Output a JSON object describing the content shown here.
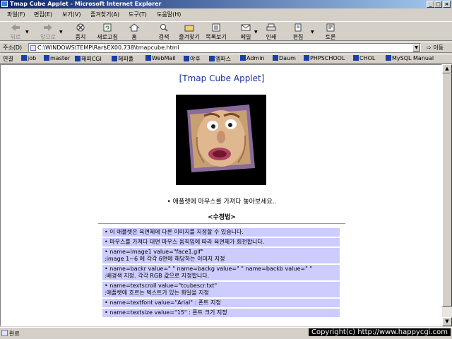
{
  "window": {
    "title": "Tmap Cube Applet - Microsoft Internet Explorer",
    "buttons": [
      "_",
      "□",
      "×"
    ]
  },
  "menu": [
    "파일(F)",
    "편집(E)",
    "보기(V)",
    "즐겨찾기(A)",
    "도구(T)",
    "도움말(H)"
  ],
  "toolbar": {
    "back": "뒤로",
    "forward": "앞으로",
    "stop": "중지",
    "refresh": "새로고침",
    "home": "홈",
    "search": "검색",
    "favorites": "즐겨찾기",
    "history": "목록보기",
    "mail": "메일",
    "print": "인쇄",
    "edit": "편집",
    "discuss": "토론"
  },
  "address": {
    "label": "주소(D)",
    "url": "C:\\WINDOWS\\TEMP\\Rar$EX00.738\\tmapcube.html",
    "go": "이동"
  },
  "links": {
    "label": "연결",
    "items": [
      "job",
      "master",
      "해피CGI",
      "해피폴",
      "WebMail",
      "야후",
      "엠파스",
      "Admin",
      "Daum",
      "PHPSCHOOL",
      "CHOL",
      "MySQL Manual"
    ]
  },
  "page": {
    "title": "[Tmap Cube Applet]",
    "hint": "• 애플렛에 마우스를 가져다 놓아보세요..",
    "method_title": "<수정법>",
    "rows": [
      [
        "• 이 애플렛은 육면체에 다른 이미지를 지정할 수 있습니다."
      ],
      [
        "• 마우스를 가져다 대면 마우스 움직임에 따라 육면체가 회전합니다."
      ],
      [
        "• name=image1 value=\"face1.gif\"",
        "  :image 1~6 에 각각 6면에 해당하는 이미지 지정"
      ],
      [
        "• name=backr value=\" \" name=backg value=\" \" name=backb value=\" \"",
        "  :배경색 지정. 각각 RGB 값으로 지정합니다."
      ],
      [
        "• name=textscroll value=\"tcubescr.txt\"",
        "  :애플렛에 흐르는 텍스트가 있는 화일을 지정"
      ],
      [
        "• name=textfont value=\"Arial\" : 폰트 지정"
      ],
      [
        "• name=textsize value=\"15\" : 폰트 크기 지정"
      ]
    ]
  },
  "status": {
    "text": "완료",
    "copyright": "Copyright(c) http://www.happycgi.com"
  },
  "colors": {
    "title_bar": "#0a246a",
    "page_title": "#1a2fa0",
    "row_bg": "#ccccff"
  }
}
